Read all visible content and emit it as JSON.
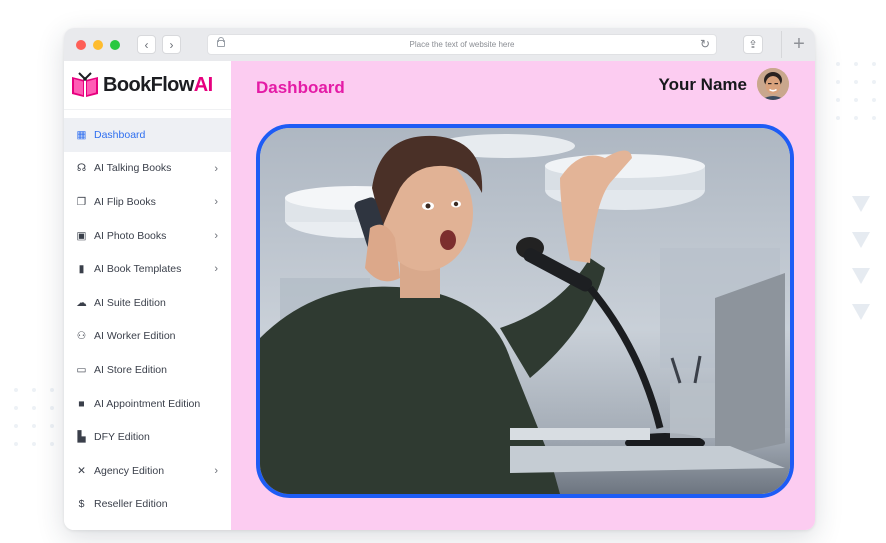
{
  "browser": {
    "address_text": "Place the text of website here",
    "back_icon": "chevron-left-icon",
    "forward_icon": "chevron-right-icon",
    "reload_icon": "reload-icon",
    "share_icon": "share-icon",
    "new_tab_icon": "plus-icon"
  },
  "brand": {
    "name_main": "BookFlow",
    "name_suffix": "AI",
    "accent_color": "#e6007e"
  },
  "sidebar": {
    "items": [
      {
        "label": "Dashboard",
        "icon": "dashboard-icon",
        "active": true,
        "has_submenu": false
      },
      {
        "label": "AI Talking Books",
        "icon": "headset-icon",
        "active": false,
        "has_submenu": true
      },
      {
        "label": "AI Flip Books",
        "icon": "open-book-icon",
        "active": false,
        "has_submenu": true
      },
      {
        "label": "AI Photo Books",
        "icon": "photo-book-icon",
        "active": false,
        "has_submenu": true
      },
      {
        "label": "AI Book Templates",
        "icon": "book-icon",
        "active": false,
        "has_submenu": true
      },
      {
        "label": "AI Suite Edition",
        "icon": "cloud-upload-icon",
        "active": false,
        "has_submenu": false
      },
      {
        "label": "AI Worker Edition",
        "icon": "users-icon",
        "active": false,
        "has_submenu": false
      },
      {
        "label": "AI Store Edition",
        "icon": "store-icon",
        "active": false,
        "has_submenu": false
      },
      {
        "label": "AI Appointment Edition",
        "icon": "briefcase-icon",
        "active": false,
        "has_submenu": false
      },
      {
        "label": "DFY Edition",
        "icon": "building-icon",
        "active": false,
        "has_submenu": false
      },
      {
        "label": "Agency Edition",
        "icon": "tools-icon",
        "active": false,
        "has_submenu": true
      },
      {
        "label": "Reseller Edition",
        "icon": "hand-dollar-icon",
        "active": false,
        "has_submenu": false
      }
    ]
  },
  "header": {
    "title": "Dashboard",
    "user_name": "Your Name"
  },
  "colors": {
    "main_background": "#fcccf1",
    "title_color": "#e41ba6",
    "hero_border": "#1e5cf5",
    "active_item": "#2f6ff0"
  },
  "hero_image": {
    "subject": "photo-woman-on-phone-at-microphone"
  }
}
